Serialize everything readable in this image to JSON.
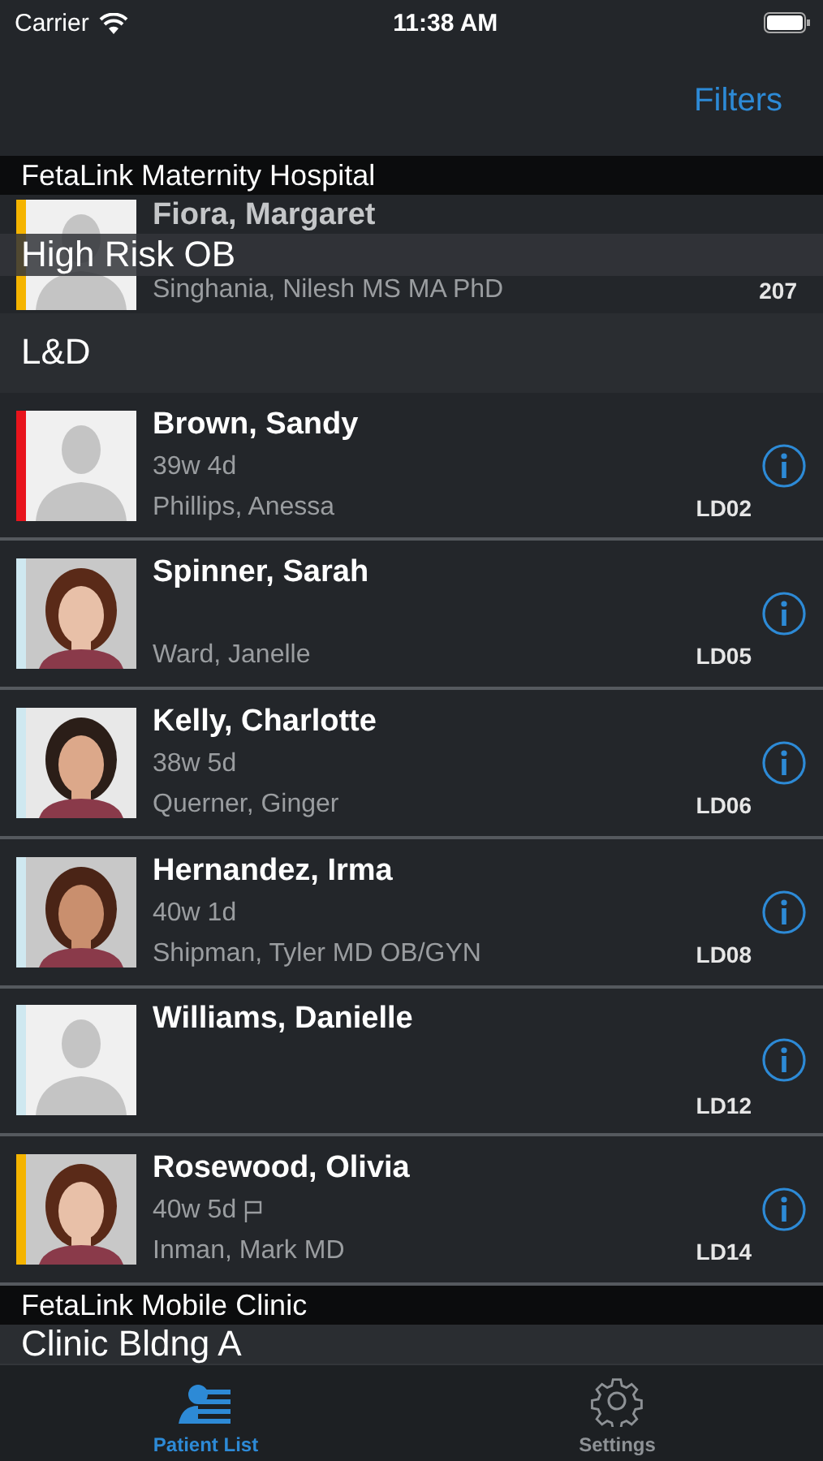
{
  "status_bar": {
    "carrier": "Carrier",
    "time": "11:38 AM"
  },
  "nav": {
    "filters": "Filters"
  },
  "facilities": [
    {
      "name": "FetaLink Maternity Hospital",
      "units": [
        {
          "name": "High Risk OB",
          "sticky": true,
          "patients": [
            {
              "name": "Fiora, Margaret",
              "provider": "Singhania, Nilesh  MS MA PhD",
              "room": "207",
              "color": "#f5b400",
              "kind": "placeholder",
              "flagged": false
            }
          ]
        },
        {
          "name": "L&D",
          "sticky": false,
          "patients": [
            {
              "name": "Brown, Sandy",
              "gestation": "39w 4d",
              "provider": "Phillips, Anessa",
              "room": "LD02",
              "color": "#e8141c",
              "kind": "placeholder",
              "flagged": false
            },
            {
              "name": "Spinner, Sarah",
              "provider": "Ward, Janelle",
              "room": "LD05",
              "color": "#cfe8f0",
              "kind": "picture",
              "flagged": false
            },
            {
              "name": "Kelly, Charlotte",
              "gestation": "38w 5d",
              "provider": "Querner, Ginger",
              "room": "LD06",
              "color": "#cfe8f0",
              "kind": "picture",
              "flagged": false
            },
            {
              "name": "Hernandez, Irma",
              "gestation": "40w 1d",
              "provider": "Shipman, Tyler MD OB/GYN",
              "room": "LD08",
              "color": "#cfe8f0",
              "kind": "picture",
              "flagged": false
            },
            {
              "name": "Williams, Danielle",
              "room": "LD12",
              "color": "#cfe8f0",
              "kind": "placeholder",
              "flagged": false
            },
            {
              "name": "Rosewood, Olivia",
              "gestation": "40w 5d",
              "provider": "Inman, Mark  MD",
              "room": "LD14",
              "color": "#f5b400",
              "kind": "picture",
              "flagged": true
            }
          ]
        }
      ]
    },
    {
      "name": "FetaLink Mobile Clinic",
      "units": [
        {
          "name": "Clinic Bldng A",
          "sticky": false
        }
      ]
    }
  ],
  "tabs": [
    {
      "label": "Patient List",
      "selected": true
    },
    {
      "label": "Settings",
      "selected": false
    }
  ]
}
